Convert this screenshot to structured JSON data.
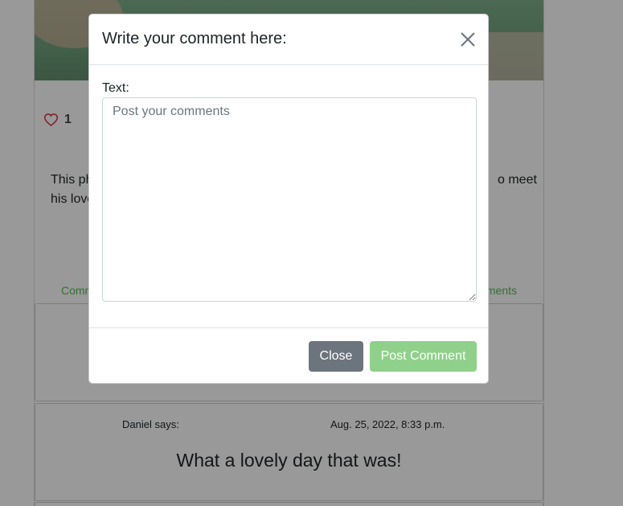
{
  "post": {
    "like_count": "1",
    "description_left_fragment": "This ph",
    "description_right_fragment": "o meet",
    "description_line2": "his love",
    "comments_link_left": "Comm",
    "comments_link_right": "nments"
  },
  "comments": [
    {
      "author_line": "",
      "date": "",
      "text": ""
    },
    {
      "author_line": "Daniel says:",
      "date": "Aug. 25, 2022, 8:33 p.m.",
      "text": "What a lovely day that was!"
    }
  ],
  "modal": {
    "title": "Write your comment here:",
    "text_label": "Text:",
    "textarea_placeholder": "Post your comments",
    "close_button_label": "Close",
    "post_button_label": "Post Comment"
  },
  "colors": {
    "accent_green": "#5cb85c",
    "post_button": "#8fd18a",
    "close_button": "#6c757d",
    "heart": "#dc3545"
  },
  "icons": {
    "like": "heart-icon",
    "close": "close-icon"
  }
}
